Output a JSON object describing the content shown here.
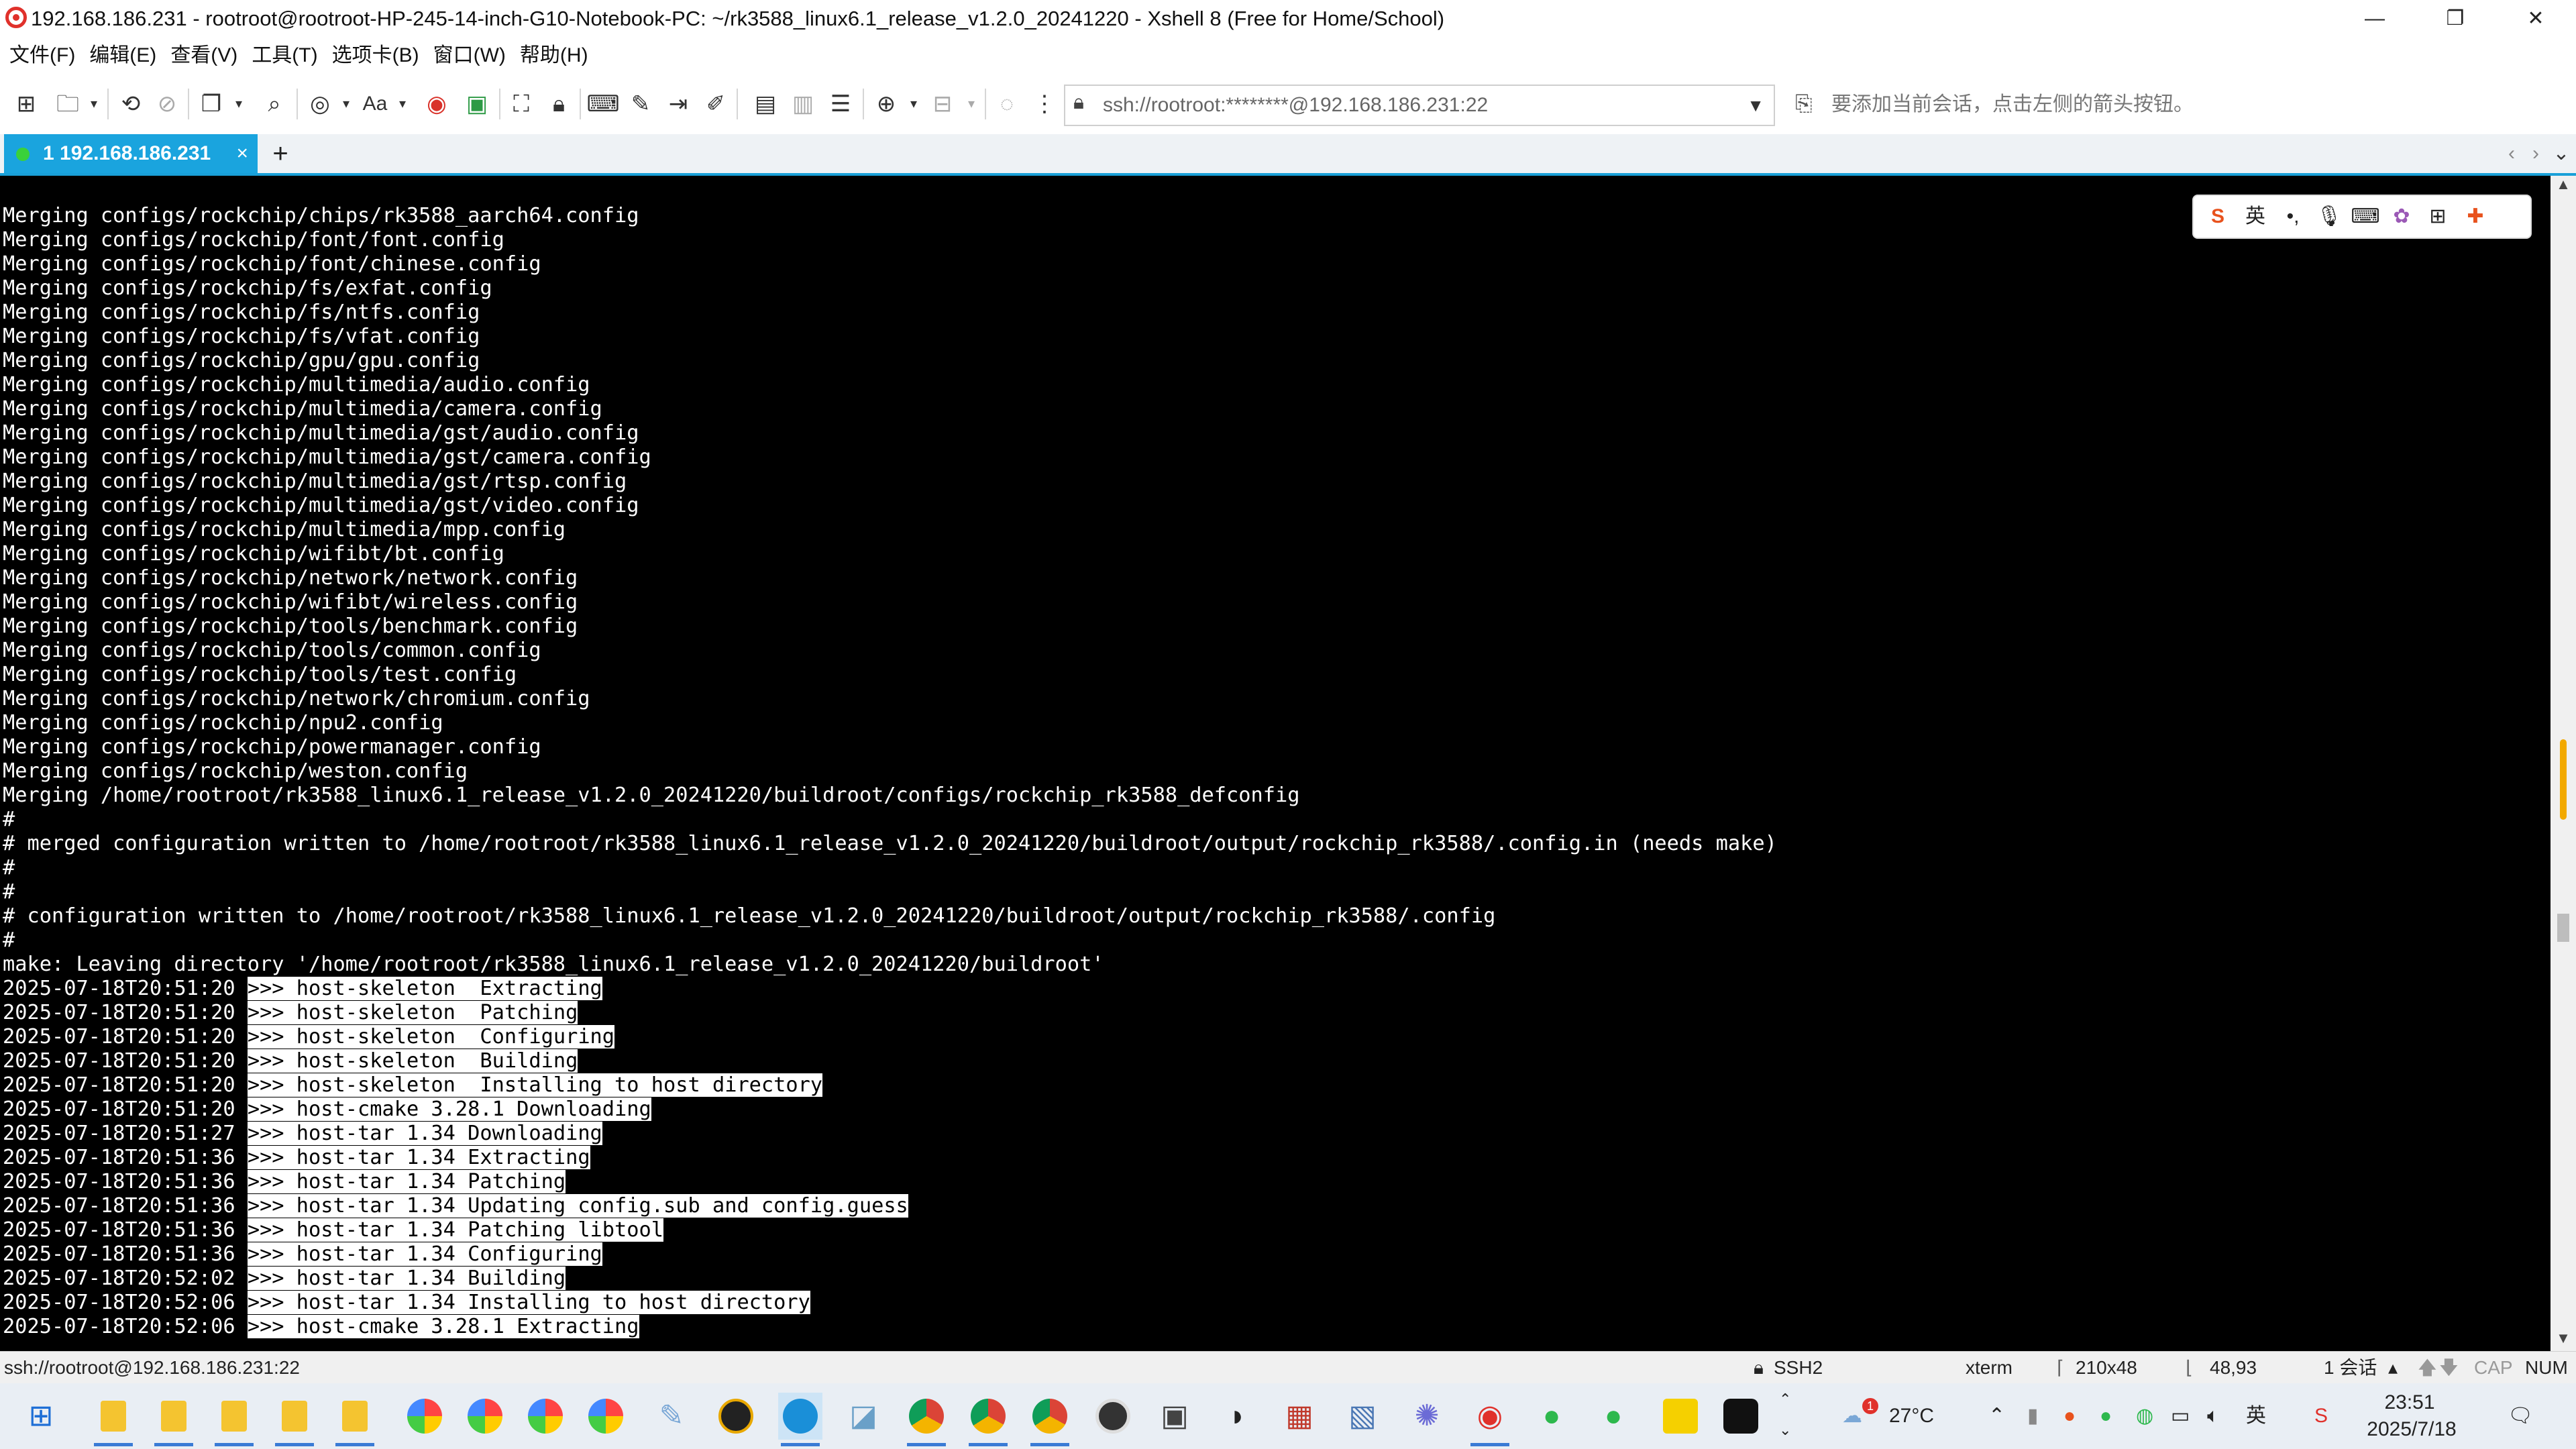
{
  "window": {
    "title": "192.168.186.231 - rootroot@rootroot-HP-245-14-inch-G10-Notebook-PC: ~/rk3588_linux6.1_release_v1.2.0_20241220 - Xshell 8 (Free for Home/School)",
    "controls": {
      "minimize": "—",
      "restore": "❐",
      "close": "✕"
    }
  },
  "menu": [
    "文件(F)",
    "编辑(E)",
    "查看(V)",
    "工具(T)",
    "选项卡(B)",
    "窗口(W)",
    "帮助(H)"
  ],
  "toolbar": {
    "address": "ssh://rootroot:********@192.168.186.231:22",
    "hint": "要添加当前会话，点击左侧的箭头按钮。",
    "font_btn": "Aa"
  },
  "tabs": {
    "active_label": "1 192.168.186.231",
    "close": "×",
    "add": "+"
  },
  "ime": {
    "brand": "S",
    "lang": "英"
  },
  "terminal": {
    "lines": [
      {
        "text": "Merging configs/rockchip/chips/rk3588_aarch64.config"
      },
      {
        "text": "Merging configs/rockchip/font/font.config"
      },
      {
        "text": "Merging configs/rockchip/font/chinese.config"
      },
      {
        "text": "Merging configs/rockchip/fs/exfat.config"
      },
      {
        "text": "Merging configs/rockchip/fs/ntfs.config"
      },
      {
        "text": "Merging configs/rockchip/fs/vfat.config"
      },
      {
        "text": "Merging configs/rockchip/gpu/gpu.config"
      },
      {
        "text": "Merging configs/rockchip/multimedia/audio.config"
      },
      {
        "text": "Merging configs/rockchip/multimedia/camera.config"
      },
      {
        "text": "Merging configs/rockchip/multimedia/gst/audio.config"
      },
      {
        "text": "Merging configs/rockchip/multimedia/gst/camera.config"
      },
      {
        "text": "Merging configs/rockchip/multimedia/gst/rtsp.config"
      },
      {
        "text": "Merging configs/rockchip/multimedia/gst/video.config"
      },
      {
        "text": "Merging configs/rockchip/multimedia/mpp.config"
      },
      {
        "text": "Merging configs/rockchip/wifibt/bt.config"
      },
      {
        "text": "Merging configs/rockchip/network/network.config"
      },
      {
        "text": "Merging configs/rockchip/wifibt/wireless.config"
      },
      {
        "text": "Merging configs/rockchip/tools/benchmark.config"
      },
      {
        "text": "Merging configs/rockchip/tools/common.config"
      },
      {
        "text": "Merging configs/rockchip/tools/test.config"
      },
      {
        "text": "Merging configs/rockchip/network/chromium.config"
      },
      {
        "text": "Merging configs/rockchip/npu2.config"
      },
      {
        "text": "Merging configs/rockchip/powermanager.config"
      },
      {
        "text": "Merging configs/rockchip/weston.config"
      },
      {
        "text": "Merging /home/rootroot/rk3588_linux6.1_release_v1.2.0_20241220/buildroot/configs/rockchip_rk3588_defconfig"
      },
      {
        "text": "#"
      },
      {
        "text": "# merged configuration written to /home/rootroot/rk3588_linux6.1_release_v1.2.0_20241220/buildroot/output/rockchip_rk3588/.config.in (needs make)"
      },
      {
        "text": "#"
      },
      {
        "text": "#"
      },
      {
        "text": "# configuration written to /home/rootroot/rk3588_linux6.1_release_v1.2.0_20241220/buildroot/output/rockchip_rk3588/.config"
      },
      {
        "text": "#"
      },
      {
        "text": "make: Leaving directory '/home/rootroot/rk3588_linux6.1_release_v1.2.0_20241220/buildroot'"
      },
      {
        "ts": "2025-07-18T20:51:20",
        "msg": ">>> host-skeleton  Extracting"
      },
      {
        "ts": "2025-07-18T20:51:20",
        "msg": ">>> host-skeleton  Patching"
      },
      {
        "ts": "2025-07-18T20:51:20",
        "msg": ">>> host-skeleton  Configuring"
      },
      {
        "ts": "2025-07-18T20:51:20",
        "msg": ">>> host-skeleton  Building"
      },
      {
        "ts": "2025-07-18T20:51:20",
        "msg": ">>> host-skeleton  Installing to host directory"
      },
      {
        "ts": "2025-07-18T20:51:20",
        "msg": ">>> host-cmake 3.28.1 Downloading"
      },
      {
        "ts": "2025-07-18T20:51:27",
        "msg": ">>> host-tar 1.34 Downloading"
      },
      {
        "ts": "2025-07-18T20:51:36",
        "msg": ">>> host-tar 1.34 Extracting"
      },
      {
        "ts": "2025-07-18T20:51:36",
        "msg": ">>> host-tar 1.34 Patching"
      },
      {
        "ts": "2025-07-18T20:51:36",
        "msg": ">>> host-tar 1.34 Updating config.sub and config.guess"
      },
      {
        "ts": "2025-07-18T20:51:36",
        "msg": ">>> host-tar 1.34 Patching libtool"
      },
      {
        "ts": "2025-07-18T20:51:36",
        "msg": ">>> host-tar 1.34 Configuring"
      },
      {
        "ts": "2025-07-18T20:52:02",
        "msg": ">>> host-tar 1.34 Building"
      },
      {
        "ts": "2025-07-18T20:52:06",
        "msg": ">>> host-tar 1.34 Installing to host directory"
      },
      {
        "ts": "2025-07-18T20:52:06",
        "msg": ">>> host-cmake 3.28.1 Extracting"
      }
    ]
  },
  "statusbar": {
    "connection": "ssh://rootroot@192.168.186.231:22",
    "protocol": "SSH2",
    "term": "xterm",
    "size": "210x48",
    "cursor": "48,93",
    "sessions": "1 会话",
    "cap": "CAP",
    "num": "NUM"
  },
  "taskbar": {
    "weather_temp": "27°C",
    "time": "23:51",
    "date": "2025/7/18",
    "notification_badge": "1",
    "ime_indicator": "英"
  },
  "colors": {
    "tab_active": "#1aa4de",
    "terminal_bg": "#000000",
    "terminal_fg": "#ffffff",
    "brand_red": "#e0312b"
  }
}
